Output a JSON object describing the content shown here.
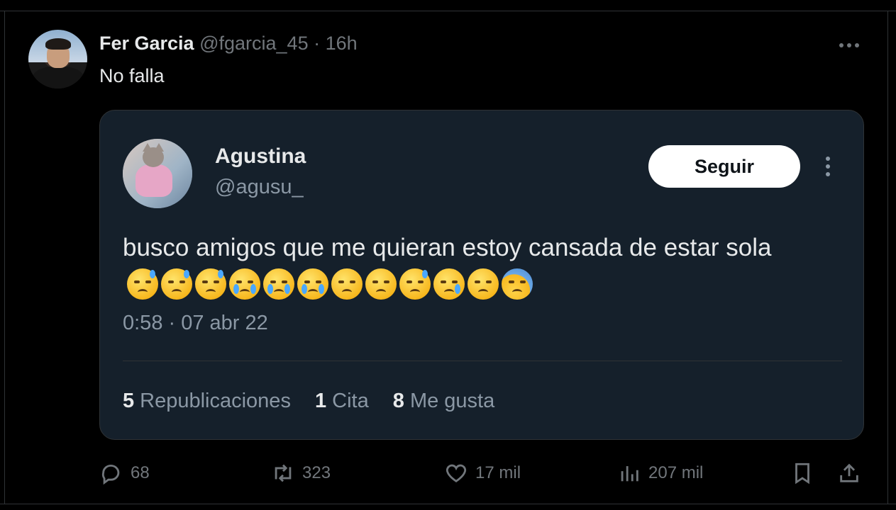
{
  "post": {
    "author_name": "Fer Garcia",
    "author_handle": "@fgarcia_45",
    "separator": "·",
    "time": "16h",
    "text": "No falla",
    "more_icon": "more-horizontal-icon"
  },
  "quote": {
    "name": "Agustina",
    "handle": "@agusu_",
    "follow_label": "Seguir",
    "more_icon": "more-vertical-icon",
    "text": "busco amigos que me quieran estoy cansada de estar sola",
    "emojis": [
      "sleepy",
      "sleepy",
      "sleepy",
      "loudly-crying",
      "loudly-crying",
      "loudly-crying",
      "worried",
      "worried",
      "downcast-sweat",
      "crying",
      "worried",
      "fearful"
    ],
    "timestamp": "0:58 · 07 abr 22",
    "stats": {
      "reposts_count": "5",
      "reposts_label": "Republicaciones",
      "quotes_count": "1",
      "quotes_label": "Cita",
      "likes_count": "8",
      "likes_label": "Me gusta"
    }
  },
  "actions": {
    "replies": "68",
    "reposts": "323",
    "likes": "17 mil",
    "views": "207 mil"
  },
  "colors": {
    "background": "#000000",
    "quote_background": "#15202b",
    "text_primary": "#e7e9ea",
    "text_secondary": "#71767b",
    "button_bg": "#ffffff"
  }
}
